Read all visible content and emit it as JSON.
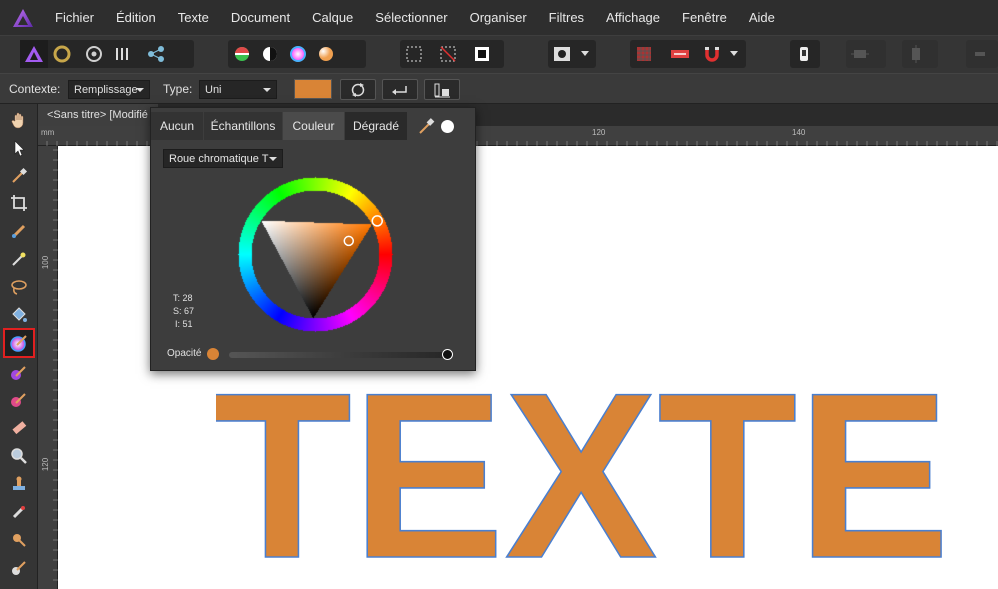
{
  "menubar": {
    "logo_icon": "affinity-designer-logo",
    "items": [
      "Fichier",
      "Édition",
      "Texte",
      "Document",
      "Calque",
      "Sélectionner",
      "Organiser",
      "Filtres",
      "Affichage",
      "Fenêtre",
      "Aide"
    ]
  },
  "context_bar": {
    "context_label": "Contexte:",
    "context_value": "Remplissage",
    "type_label": "Type:",
    "type_value": "Uni",
    "fill_color": "#d98436"
  },
  "document": {
    "tab_title": "<Sans titre> [Modifié",
    "ruler_unit": "mm",
    "h_ticks": [
      "120",
      "140"
    ],
    "v_ticks": [
      "100",
      "120"
    ]
  },
  "canvas": {
    "text": "TEXTE",
    "text_fill": "#d98436",
    "text_stroke": "#4a7fcf"
  },
  "color_popover": {
    "tabs": [
      "Aucun",
      "Échantillons",
      "Couleur",
      "Dégradé"
    ],
    "active_tab": "Couleur",
    "wheel_mode": "Roue chromatique T",
    "hsl": [
      "T: 28",
      "S: 67",
      "I: 51"
    ],
    "opacity_label": "Opacité",
    "opacity_value": 1.0,
    "hue_degrees": 28
  }
}
